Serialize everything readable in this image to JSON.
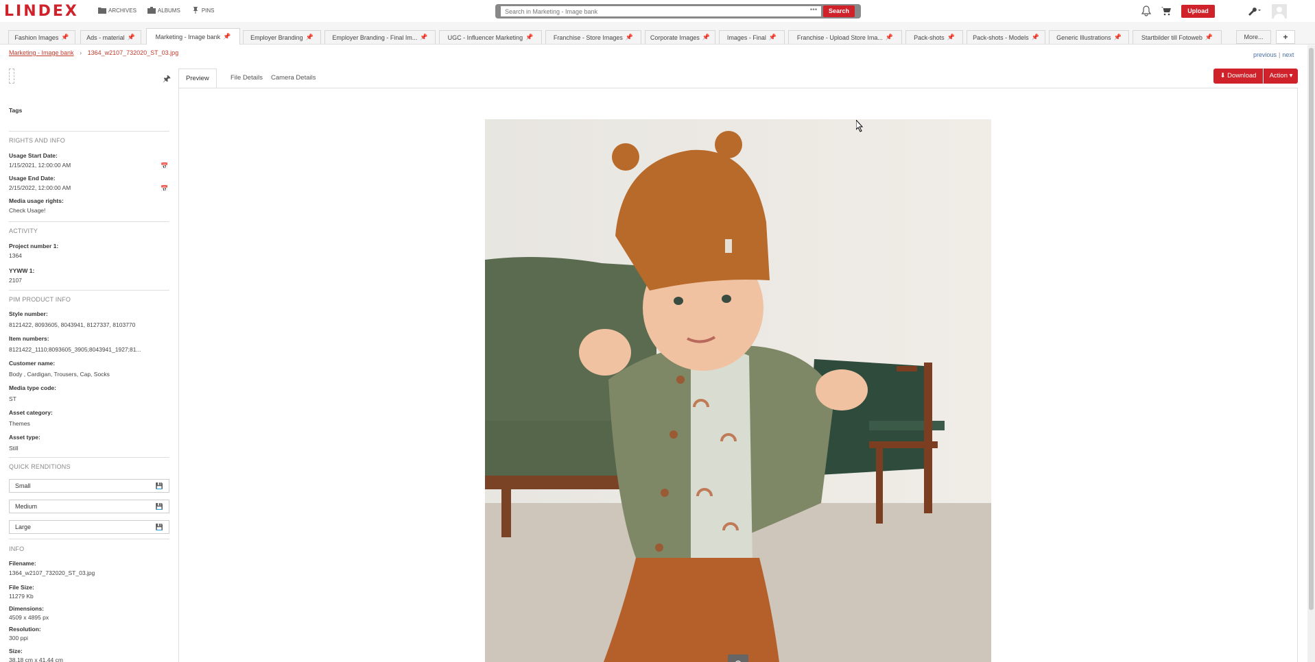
{
  "header": {
    "logo": "LINDEX",
    "nav": [
      {
        "label": "ARCHIVES",
        "icon": "folder-icon"
      },
      {
        "label": "ALBUMS",
        "icon": "briefcase-icon"
      },
      {
        "label": "PINS",
        "icon": "pin-icon"
      }
    ],
    "search_placeholder": "Search in Marketing - Image bank",
    "search_dots": "•••",
    "search_label": "Search",
    "upload_label": "Upload"
  },
  "tabs": [
    {
      "label": "Fashion Images"
    },
    {
      "label": "Ads - material"
    },
    {
      "label": "Marketing - Image bank"
    },
    {
      "label": "Employer Branding"
    },
    {
      "label": "Employer Branding - Final Im..."
    },
    {
      "label": "UGC - Influencer Marketing"
    },
    {
      "label": "Franchise - Store Images"
    },
    {
      "label": "Corporate Images"
    },
    {
      "label": "Images - Final"
    },
    {
      "label": "Franchise - Upload Store Ima..."
    },
    {
      "label": "Pack-shots"
    },
    {
      "label": "Pack-shots - Models"
    },
    {
      "label": "Generic Illustrations"
    },
    {
      "label": "Startbilder till Fotoweb"
    }
  ],
  "tab_more": "More...",
  "tab_plus": "+",
  "breadcrumb": {
    "parent": "Marketing - Image bank",
    "current": "1364_w2107_732020_ST_03.jpg"
  },
  "pager": {
    "previous": "previous",
    "sep": "|",
    "next": "next"
  },
  "left": {
    "tags_label": "Tags",
    "rights_section": "RIGHTS AND INFO",
    "usage_start_label": "Usage Start Date:",
    "usage_start_value": "1/15/2021, 12:00:00 AM",
    "usage_end_label": "Usage End Date:",
    "usage_end_value": "2/15/2022, 12:00:00 AM",
    "media_rights_label": "Media usage rights:",
    "media_rights_value": "Check Usage!",
    "activity_section": "ACTIVITY",
    "project_label": "Project number 1:",
    "project_value": "1364",
    "yyww_label": "YYWW 1:",
    "yyww_value": "2107",
    "pim_section": "PIM PRODUCT INFO",
    "style_label": "Style number:",
    "style_value": "8121422, 8093605, 8043941, 8127337, 8103770",
    "item_label": "Item numbers:",
    "item_value": "8121422_1110;8093605_3905;8043941_1927;81...",
    "customer_label": "Customer name:",
    "customer_value": "Body , Cardigan, Trousers, Cap, Socks",
    "media_type_label": "Media type code:",
    "media_type_value": "ST",
    "asset_cat_label": "Asset category:",
    "asset_cat_value": "Themes",
    "asset_type_label": "Asset type:",
    "asset_type_value": "Still",
    "quick_section": "QUICK RENDITIONS",
    "rendition_small": "Small",
    "rendition_medium": "Medium",
    "rendition_large": "Large",
    "info_section": "INFO",
    "filename_label": "Filename:",
    "filename_value": "1364_w2107_732020_ST_03.jpg",
    "filesize_label": "File Size:",
    "filesize_value": "11279 Kb",
    "dimensions_label": "Dimensions:",
    "dimensions_value": "4509 x 4895 px",
    "resolution_label": "Resolution:",
    "resolution_value": "300 ppi",
    "size_label": "Size:",
    "size_value": "38.18 cm x 41.44 cm"
  },
  "content": {
    "subtabs": [
      "Preview",
      "File Details",
      "Camera Details"
    ],
    "download_label": "Download",
    "action_label": "Action"
  },
  "colors": {
    "brand_red": "#d0222a",
    "pin_orange": "#e5731f",
    "link_blue": "#4a6fa5"
  }
}
